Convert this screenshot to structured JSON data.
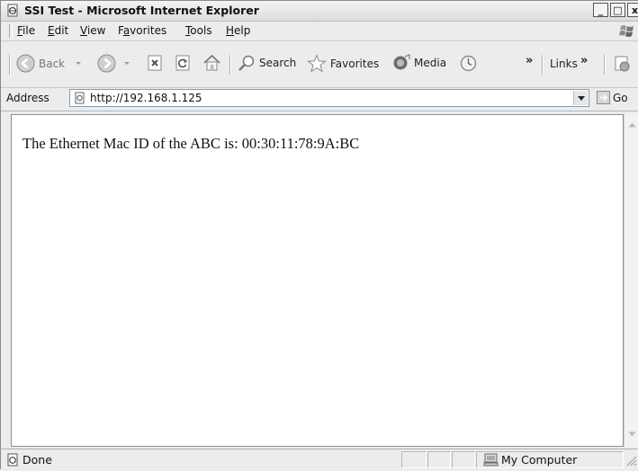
{
  "window": {
    "title": "SSI Test - Microsoft Internet Explorer",
    "controls": {
      "minimize": "_",
      "maximize": "□",
      "close": "x"
    }
  },
  "menubar": {
    "items": [
      {
        "label": "File",
        "accel": "F"
      },
      {
        "label": "Edit",
        "accel": "E"
      },
      {
        "label": "View",
        "accel": "V"
      },
      {
        "label": "Favorites",
        "accel": "a"
      },
      {
        "label": "Tools",
        "accel": "T"
      },
      {
        "label": "Help",
        "accel": "H"
      }
    ]
  },
  "toolbar": {
    "back_label": "Back",
    "search_label": "Search",
    "favorites_label": "Favorites",
    "media_label": "Media",
    "chevron": "»",
    "links_label": "Links"
  },
  "address": {
    "label": "Address",
    "url": "http://192.168.1.125",
    "go_label": "Go"
  },
  "page": {
    "text": "The Ethernet Mac ID of the ABC is: 00:30:11:78:9A:BC"
  },
  "statusbar": {
    "status": "Done",
    "zone": "My Computer"
  },
  "icons": [
    "ie-page-icon",
    "windows-logo-icon",
    "back-arrow-icon",
    "forward-arrow-icon",
    "stop-icon",
    "refresh-icon",
    "home-icon",
    "search-icon",
    "favorites-star-icon",
    "media-icon",
    "history-icon",
    "links-page-icon",
    "go-arrow-icon",
    "dropdown-arrow-icon",
    "page-done-icon",
    "my-computer-icon",
    "scroll-up-arrow-icon",
    "scroll-down-arrow-icon",
    "resize-grip-icon"
  ]
}
